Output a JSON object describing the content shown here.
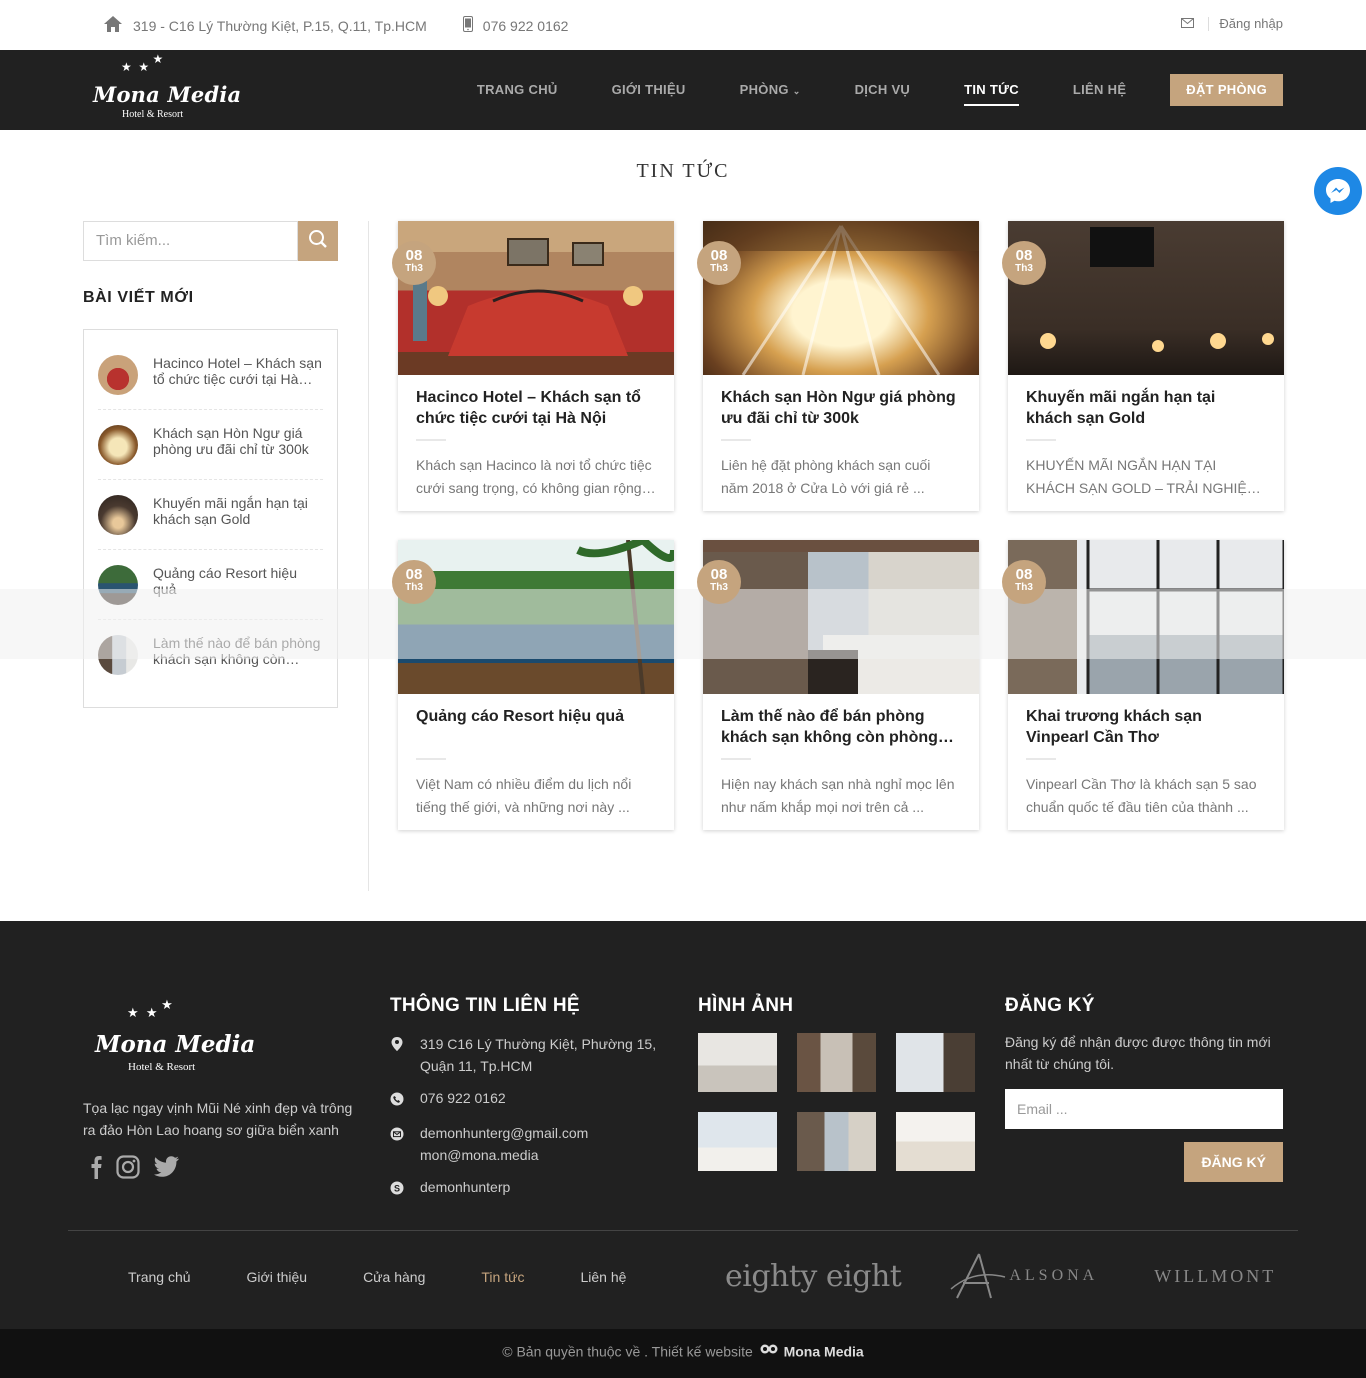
{
  "topbar": {
    "address": "319 - C16 Lý Thường Kiệt, P.15, Q.11, Tp.HCM",
    "phone": "076 922 0162",
    "login": "Đăng nhập"
  },
  "logo": {
    "brand": "Mona Media",
    "sub": "Hotel & Resort"
  },
  "nav": {
    "items": [
      "TRANG CHỦ",
      "GIỚI THIỆU",
      "PHÒNG",
      "DỊCH VỤ",
      "TIN TỨC",
      "LIÊN HỆ"
    ],
    "active": "TIN TỨC",
    "book": "ĐẶT PHÒNG"
  },
  "page_title": "TIN TỨC",
  "sidebar": {
    "search_placeholder": "Tìm kiếm...",
    "recent_title": "BÀI VIẾT MỚI",
    "recent": [
      "Hacinco Hotel – Khách sạn tổ chức tiệc cưới tại Hà Nội",
      "Khách sạn Hòn Ngư giá phòng ưu đãi chỉ từ 300k",
      "Khuyến mãi ngắn hạn tại khách sạn Gold",
      "Quảng cáo Resort hiệu quả",
      "Làm thế nào để bán phòng khách sạn không còn phòng trống"
    ]
  },
  "posts": [
    {
      "day": "08",
      "month": "Th3",
      "title": "Hacinco Hotel – Khách sạn tổ chức tiệc cưới tại Hà Nội",
      "excerpt": "Khách sạn Hacinco là nơi tổ chức tiệc cưới sang trọng, có không gian rộng rãi"
    },
    {
      "day": "08",
      "month": "Th3",
      "title": "Khách sạn Hòn Ngư giá phòng ưu đãi chỉ từ 300k",
      "excerpt": "Liên hệ đặt phòng khách sạn cuối năm 2018 ở Cửa Lò với giá rẻ ..."
    },
    {
      "day": "08",
      "month": "Th3",
      "title": "Khuyến mãi ngắn hạn tại khách sạn Gold",
      "excerpt": "KHUYẾN MÃI NGẮN HẠN TẠI KHÁCH SẠN GOLD – TRẢI NGHIỆM THU VỊ"
    },
    {
      "day": "08",
      "month": "Th3",
      "title": "Quảng cáo Resort hiệu quả",
      "excerpt": "Việt Nam có nhiều điểm du lịch nổi tiếng thế giới, và những nơi này ..."
    },
    {
      "day": "08",
      "month": "Th3",
      "title": "Làm thế nào để bán phòng khách sạn không còn phòng trống",
      "excerpt": "Hiện nay khách sạn nhà nghỉ mọc lên như nấm khắp mọi nơi trên cả ..."
    },
    {
      "day": "08",
      "month": "Th3",
      "title": "Khai trương khách sạn Vinpearl Cần Thơ",
      "excerpt": "Vinpearl Cần Thơ là khách sạn 5 sao chuẩn quốc tế đầu tiên của thành ..."
    }
  ],
  "footer": {
    "logo_brand": "Mona Media",
    "logo_sub": "Hotel & Resort",
    "desc": "Tọa lạc ngay vịnh Mũi Né xinh đẹp và trông ra đảo Hòn Lao hoang sơ giữa biển xanh",
    "contact_title": "THÔNG TIN LIÊN HỆ",
    "contact_address": "319 C16 Lý Thường Kiệt, Phường 15, Quận 11, Tp.HCM",
    "contact_phone": "076 922 0162",
    "contact_email1": "demonhunterg@gmail.com",
    "contact_email2": "mon@mona.media",
    "contact_skype": "demonhunterp",
    "gallery_title": "HÌNH ẢNH",
    "subscribe_title": "ĐĂNG KÝ",
    "subscribe_text": "Đăng ký để nhận được được thông tin mới nhất từ chúng tôi.",
    "email_placeholder": "Email ...",
    "subscribe_button": "ĐĂNG KÝ",
    "nav": [
      "Trang chủ",
      "Giới thiệu",
      "Cửa hàng",
      "Tin tức",
      "Liên hệ"
    ],
    "nav_active": "Tin tức",
    "partners": [
      "eighty eight",
      "ALSONA",
      "WILLMONT"
    ],
    "copyright": "© Bản quyền thuộc về . Thiết kế website",
    "copyright_brand": "Mona Media"
  },
  "colors": {
    "accent": "#c5a47e",
    "header_bg": "#212121",
    "footer_bg": "#212121"
  }
}
